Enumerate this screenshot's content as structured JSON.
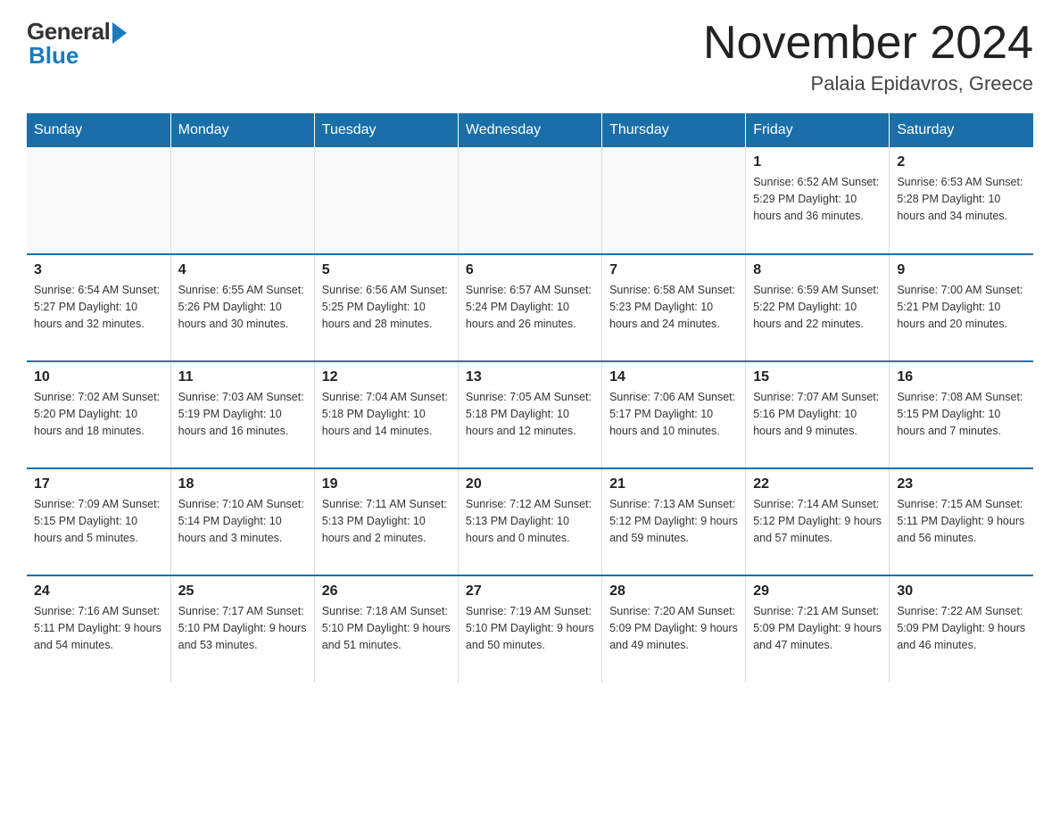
{
  "header": {
    "logo": {
      "general": "General",
      "blue": "Blue"
    },
    "title": "November 2024",
    "location": "Palaia Epidavros, Greece"
  },
  "weekdays": [
    "Sunday",
    "Monday",
    "Tuesday",
    "Wednesday",
    "Thursday",
    "Friday",
    "Saturday"
  ],
  "weeks": [
    [
      {
        "day": "",
        "info": ""
      },
      {
        "day": "",
        "info": ""
      },
      {
        "day": "",
        "info": ""
      },
      {
        "day": "",
        "info": ""
      },
      {
        "day": "",
        "info": ""
      },
      {
        "day": "1",
        "info": "Sunrise: 6:52 AM\nSunset: 5:29 PM\nDaylight: 10 hours and 36 minutes."
      },
      {
        "day": "2",
        "info": "Sunrise: 6:53 AM\nSunset: 5:28 PM\nDaylight: 10 hours and 34 minutes."
      }
    ],
    [
      {
        "day": "3",
        "info": "Sunrise: 6:54 AM\nSunset: 5:27 PM\nDaylight: 10 hours and 32 minutes."
      },
      {
        "day": "4",
        "info": "Sunrise: 6:55 AM\nSunset: 5:26 PM\nDaylight: 10 hours and 30 minutes."
      },
      {
        "day": "5",
        "info": "Sunrise: 6:56 AM\nSunset: 5:25 PM\nDaylight: 10 hours and 28 minutes."
      },
      {
        "day": "6",
        "info": "Sunrise: 6:57 AM\nSunset: 5:24 PM\nDaylight: 10 hours and 26 minutes."
      },
      {
        "day": "7",
        "info": "Sunrise: 6:58 AM\nSunset: 5:23 PM\nDaylight: 10 hours and 24 minutes."
      },
      {
        "day": "8",
        "info": "Sunrise: 6:59 AM\nSunset: 5:22 PM\nDaylight: 10 hours and 22 minutes."
      },
      {
        "day": "9",
        "info": "Sunrise: 7:00 AM\nSunset: 5:21 PM\nDaylight: 10 hours and 20 minutes."
      }
    ],
    [
      {
        "day": "10",
        "info": "Sunrise: 7:02 AM\nSunset: 5:20 PM\nDaylight: 10 hours and 18 minutes."
      },
      {
        "day": "11",
        "info": "Sunrise: 7:03 AM\nSunset: 5:19 PM\nDaylight: 10 hours and 16 minutes."
      },
      {
        "day": "12",
        "info": "Sunrise: 7:04 AM\nSunset: 5:18 PM\nDaylight: 10 hours and 14 minutes."
      },
      {
        "day": "13",
        "info": "Sunrise: 7:05 AM\nSunset: 5:18 PM\nDaylight: 10 hours and 12 minutes."
      },
      {
        "day": "14",
        "info": "Sunrise: 7:06 AM\nSunset: 5:17 PM\nDaylight: 10 hours and 10 minutes."
      },
      {
        "day": "15",
        "info": "Sunrise: 7:07 AM\nSunset: 5:16 PM\nDaylight: 10 hours and 9 minutes."
      },
      {
        "day": "16",
        "info": "Sunrise: 7:08 AM\nSunset: 5:15 PM\nDaylight: 10 hours and 7 minutes."
      }
    ],
    [
      {
        "day": "17",
        "info": "Sunrise: 7:09 AM\nSunset: 5:15 PM\nDaylight: 10 hours and 5 minutes."
      },
      {
        "day": "18",
        "info": "Sunrise: 7:10 AM\nSunset: 5:14 PM\nDaylight: 10 hours and 3 minutes."
      },
      {
        "day": "19",
        "info": "Sunrise: 7:11 AM\nSunset: 5:13 PM\nDaylight: 10 hours and 2 minutes."
      },
      {
        "day": "20",
        "info": "Sunrise: 7:12 AM\nSunset: 5:13 PM\nDaylight: 10 hours and 0 minutes."
      },
      {
        "day": "21",
        "info": "Sunrise: 7:13 AM\nSunset: 5:12 PM\nDaylight: 9 hours and 59 minutes."
      },
      {
        "day": "22",
        "info": "Sunrise: 7:14 AM\nSunset: 5:12 PM\nDaylight: 9 hours and 57 minutes."
      },
      {
        "day": "23",
        "info": "Sunrise: 7:15 AM\nSunset: 5:11 PM\nDaylight: 9 hours and 56 minutes."
      }
    ],
    [
      {
        "day": "24",
        "info": "Sunrise: 7:16 AM\nSunset: 5:11 PM\nDaylight: 9 hours and 54 minutes."
      },
      {
        "day": "25",
        "info": "Sunrise: 7:17 AM\nSunset: 5:10 PM\nDaylight: 9 hours and 53 minutes."
      },
      {
        "day": "26",
        "info": "Sunrise: 7:18 AM\nSunset: 5:10 PM\nDaylight: 9 hours and 51 minutes."
      },
      {
        "day": "27",
        "info": "Sunrise: 7:19 AM\nSunset: 5:10 PM\nDaylight: 9 hours and 50 minutes."
      },
      {
        "day": "28",
        "info": "Sunrise: 7:20 AM\nSunset: 5:09 PM\nDaylight: 9 hours and 49 minutes."
      },
      {
        "day": "29",
        "info": "Sunrise: 7:21 AM\nSunset: 5:09 PM\nDaylight: 9 hours and 47 minutes."
      },
      {
        "day": "30",
        "info": "Sunrise: 7:22 AM\nSunset: 5:09 PM\nDaylight: 9 hours and 46 minutes."
      }
    ]
  ]
}
